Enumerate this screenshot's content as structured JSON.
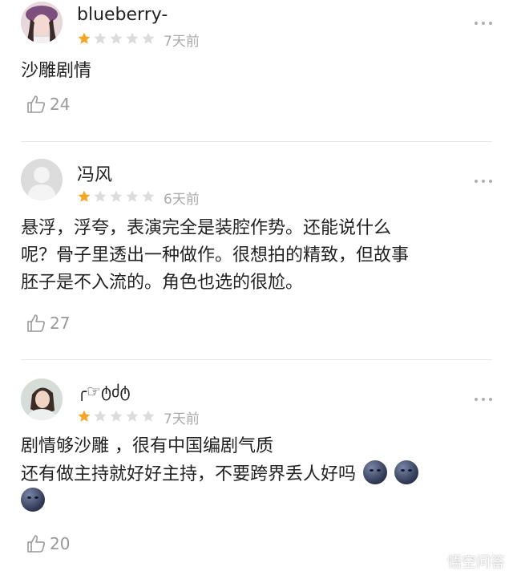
{
  "reviews": [
    {
      "username": "blueberry-",
      "rating": 1,
      "max_rating": 5,
      "time": "7天前",
      "content": "沙雕剧情",
      "likes": "24",
      "avatar_icon": "girl-avatar"
    },
    {
      "username": "冯风",
      "rating": 1,
      "max_rating": 5,
      "time": "6天前",
      "content": "悬浮，浮夸，表演完全是装腔作势。还能说什么\n呢？骨子里透出一种做作。很想拍的精致，但故事\n胚子是不入流的。角色也选的很尬。",
      "likes": "27",
      "avatar_icon": "default-user-avatar"
    },
    {
      "username": "╭☞ტძტ",
      "rating": 1,
      "max_rating": 5,
      "time": "7天前",
      "content_line1": "剧情够沙雕 ，很有中国编剧气质",
      "content_line2": "还有做主持就好好主持，不要跨界丢人好吗",
      "likes": "20",
      "avatar_icon": "girl-avatar"
    }
  ],
  "colors": {
    "star_active": "#f5a623",
    "star_inactive": "#dcdcdc",
    "meta_text": "#aaaaaa"
  },
  "watermark": {
    "text": "悟空问答",
    "icon": "eye-logo-icon"
  }
}
